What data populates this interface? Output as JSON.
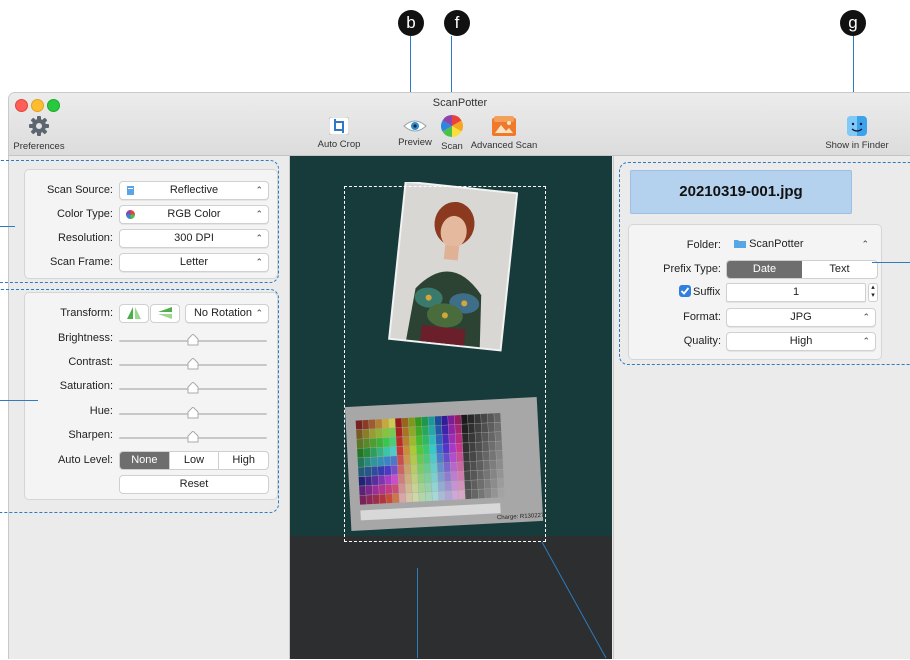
{
  "callouts": {
    "b": "b",
    "f": "f",
    "g": "g"
  },
  "window": {
    "title": "ScanPotter"
  },
  "toolbar": {
    "preferences": "Preferences",
    "auto_crop": "Auto Crop",
    "preview": "Preview",
    "scan": "Scan",
    "advanced_scan": "Advanced Scan",
    "show_in_finder": "Show in Finder"
  },
  "scan_settings": {
    "source_label": "Scan Source:",
    "source_value": "Reflective",
    "color_label": "Color Type:",
    "color_value": "RGB Color",
    "resolution_label": "Resolution:",
    "resolution_value": "300 DPI",
    "frame_label": "Scan Frame:",
    "frame_value": "Letter"
  },
  "adjustments": {
    "transform_label": "Transform:",
    "rotation_value": "No Rotation",
    "brightness_label": "Brightness:",
    "contrast_label": "Contrast:",
    "saturation_label": "Saturation:",
    "hue_label": "Hue:",
    "sharpen_label": "Sharpen:",
    "auto_level_label": "Auto Level:",
    "auto_level_options": [
      "None",
      "Low",
      "High"
    ],
    "auto_level_selected": "None",
    "reset": "Reset"
  },
  "slider_levels": {
    "brightness": 0.5,
    "contrast": 0.5,
    "saturation": 0.5,
    "hue": 0.5,
    "sharpen": 0.5
  },
  "output": {
    "filename": "20210319-001.jpg",
    "folder_label": "Folder:",
    "folder_value": "ScanPotter",
    "prefix_label": "Prefix Type:",
    "prefix_options": [
      "Date",
      "Text"
    ],
    "prefix_selected": "Date",
    "suffix_label": "Suffix",
    "suffix_checked": true,
    "suffix_value": "1",
    "format_label": "Format:",
    "format_value": "JPG",
    "quality_label": "Quality:",
    "quality_value": "High"
  },
  "preview": {
    "chart_caption": "Charge: R130227"
  },
  "colors": {
    "accent": "#2e7bc0",
    "selected_segment": "#6e6e6e",
    "filename_bg": "#b4d1ee",
    "preview_bg": "#2b2d2e"
  }
}
